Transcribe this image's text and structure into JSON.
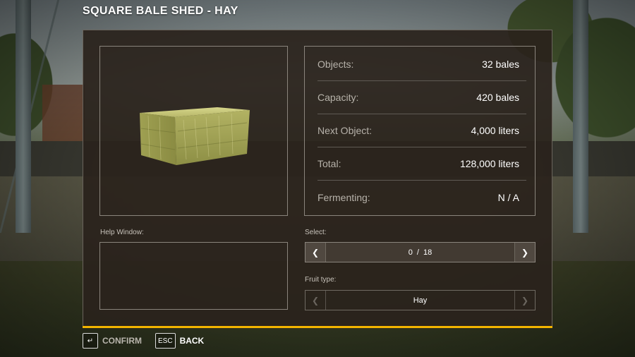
{
  "title": "SQUARE BALE SHED - HAY",
  "stats": [
    {
      "label": "Objects:",
      "value": "32 bales"
    },
    {
      "label": "Capacity:",
      "value": "420 bales"
    },
    {
      "label": "Next Object:",
      "value": "4,000 liters"
    },
    {
      "label": "Total:",
      "value": "128,000 liters"
    },
    {
      "label": "Fermenting:",
      "value": "N / A"
    }
  ],
  "help": {
    "label": "Help Window:"
  },
  "select": {
    "label": "Select:",
    "current": "0",
    "separator": "/",
    "total": "18",
    "left_arrow": "❮",
    "right_arrow": "❯"
  },
  "fruit": {
    "label": "Fruit type:",
    "value": "Hay",
    "left_arrow": "❮",
    "right_arrow": "❯"
  },
  "footer": {
    "confirm_key": "↵",
    "confirm_label": "CONFIRM",
    "back_key": "ESC",
    "back_label": "BACK"
  },
  "colors": {
    "accent": "#f3b400",
    "panel": "#2a221c",
    "border": "#8a847c"
  },
  "icons": [
    "hay-bale-image",
    "chevron-left-icon",
    "chevron-right-icon",
    "enter-key-icon",
    "esc-key-icon"
  ]
}
